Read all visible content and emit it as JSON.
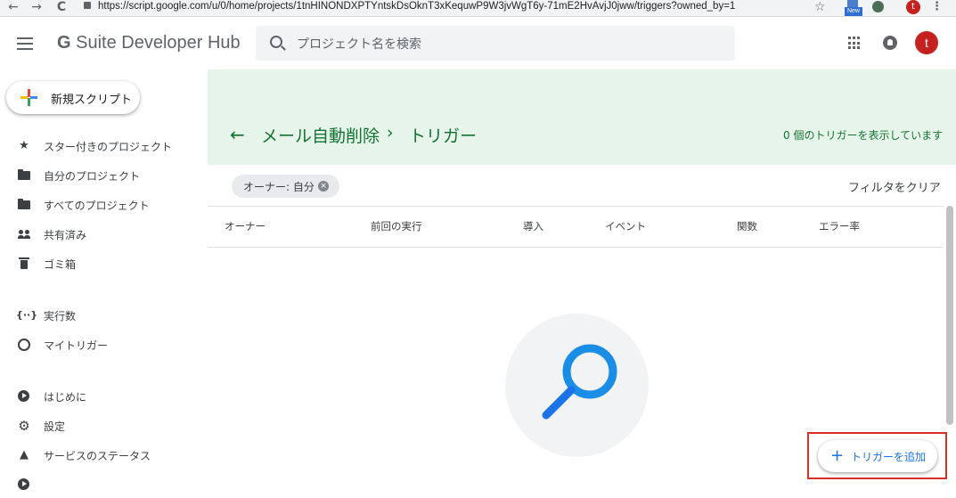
{
  "browser": {
    "back": "←",
    "forward": "→",
    "reload": "C",
    "url": "https://script.google.com/u/0/home/projects/1tnHINONDXPTYntskDsOknT3xKequwP9W3jvWgT6y-71mE2HvAvjJ0jww/triggers?owned_by=1",
    "star": "☆",
    "new_badge": "New",
    "profile_initial": "t",
    "menu": "⋮"
  },
  "header": {
    "title_g": "G",
    "title_rest": " Suite Developer Hub",
    "search_placeholder": "プロジェクト名を検索",
    "avatar_initial": "t"
  },
  "sidebar": {
    "new_script": "新規スクリプト",
    "items": [
      {
        "label": "スター付きのプロジェクト",
        "icon": "star-icon"
      },
      {
        "label": "自分のプロジェクト",
        "icon": "folder-icon"
      },
      {
        "label": "すべてのプロジェクト",
        "icon": "folder-icon"
      },
      {
        "label": "共有済み",
        "icon": "people-icon"
      },
      {
        "label": "ゴミ箱",
        "icon": "trash-icon"
      },
      {
        "label": "実行数",
        "icon": "executions-icon"
      },
      {
        "label": "マイトリガー",
        "icon": "alarm-icon"
      },
      {
        "label": "はじめに",
        "icon": "play-circle-icon"
      },
      {
        "label": "設定",
        "icon": "gear-icon"
      },
      {
        "label": "サービスのステータス",
        "icon": "warning-icon"
      }
    ]
  },
  "main": {
    "back_arrow": "←",
    "breadcrumb_project": "メール自動削除",
    "breadcrumb_sep": "›",
    "breadcrumb_current": "トリガー",
    "trigger_count": "0 個のトリガーを表示しています",
    "owner_chip": "オーナー: 自分",
    "clear_filter": "フィルタをクリア",
    "columns": [
      "オーナー",
      "前回の実行",
      "導入",
      "イベント",
      "関数",
      "エラー率"
    ],
    "add_trigger": "トリガーを追加",
    "add_plus": "+"
  },
  "colors": {
    "accent_green": "#137333",
    "header_green_bg": "#e6f4ea",
    "link_blue": "#1a73e8",
    "highlight_red": "#d93025"
  }
}
